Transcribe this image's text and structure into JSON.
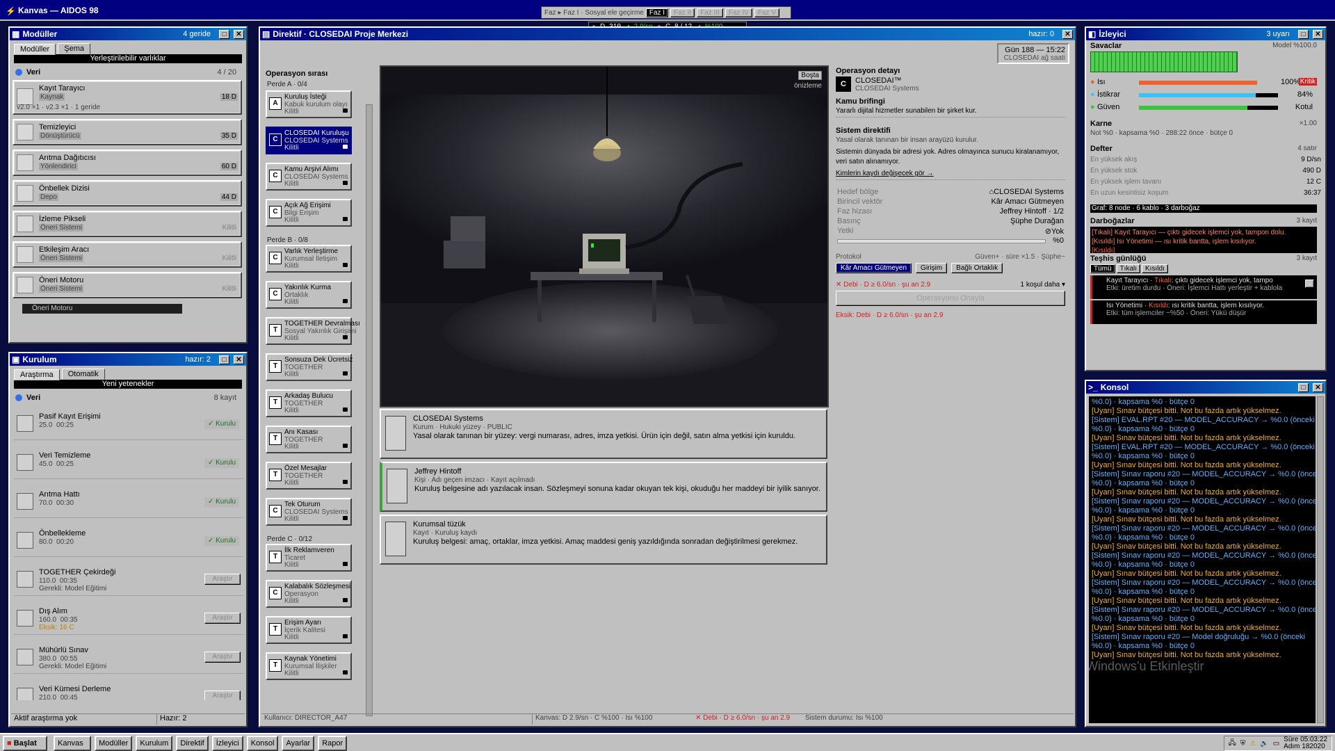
{
  "app": {
    "title": "Kanvas — AIDOS 98"
  },
  "top_phase": {
    "label": "Faz ▸ Faz I · Sosyal ele geçirme",
    "tabs": [
      "Faz I",
      "Faz II",
      "Faz III",
      "Faz IV",
      "Faz V"
    ]
  },
  "stats_strip": {
    "d_label": "D",
    "d_value": "319",
    "rate": "▲ 2.9/sn",
    "c_label": "C",
    "c_value": "8 / 12",
    "pct": "▲ %100"
  },
  "modules": {
    "title": "Modüller",
    "status": "4 geride",
    "tabs": [
      "Modüller",
      "Şema"
    ],
    "bar": "Yerleştirilebilir varlıklar",
    "section": "Veri",
    "count": "4 / 20",
    "items": [
      {
        "name": "Kayıt Tarayıcı",
        "sub": "Kaynak",
        "extra": "v2.0 ×1 · v2.3 ×1 · 1 geride",
        "right": "18 D"
      },
      {
        "name": "Temizleyici",
        "sub": "Dönüştürücü",
        "extra": "",
        "right": "35 D"
      },
      {
        "name": "Arıtma Dağıtıcısı",
        "sub": "Yönlendirici",
        "extra": "",
        "right": "60 D"
      },
      {
        "name": "Önbellek Dizisi",
        "sub": "Depo",
        "extra": "",
        "right": "44 D"
      },
      {
        "name": "İzleme Pikseli",
        "sub": "Öneri Sistemi",
        "extra": "",
        "right": "Kilitli"
      },
      {
        "name": "Etkileşim Aracı",
        "sub": "Öneri Sistemi",
        "extra": "",
        "right": "Kilitli"
      },
      {
        "name": "Öneri Motoru",
        "sub": "Öneri Sistemi",
        "extra": "",
        "right": "Kilitli"
      }
    ],
    "peek": "Öneri Motoru"
  },
  "install": {
    "title": "Kurulum",
    "status": "hazır: 2",
    "tabs": [
      "Araştırma",
      "Otomatik"
    ],
    "bar": "Yeni yetenekler",
    "section": "Veri",
    "count": "8 kayıt",
    "items": [
      {
        "name": "Pasif Kayıt Erişimi",
        "cost": "25.0",
        "time": "00:25",
        "note": "",
        "action": "✓ Kurulu"
      },
      {
        "name": "Veri Temizleme",
        "cost": "45.0",
        "time": "00:25",
        "note": "",
        "action": "✓ Kurulu"
      },
      {
        "name": "Arıtma Hattı",
        "cost": "70.0",
        "time": "00:30",
        "note": "",
        "action": "✓ Kurulu"
      },
      {
        "name": "Önbellekleme",
        "cost": "80.0",
        "time": "00:20",
        "note": "",
        "action": "✓ Kurulu"
      },
      {
        "name": "TOGETHER Çekirdeği",
        "cost": "110.0",
        "time": "00:35",
        "note": "Gerekli: Model Eğitimi",
        "action": "Araştır"
      },
      {
        "name": "Dış Alım",
        "cost": "160.0",
        "time": "00:35",
        "note": "Eksik: 16 C",
        "action": "Araştır"
      },
      {
        "name": "Mühürlü Sınav",
        "cost": "380.0",
        "time": "00:55",
        "note": "Gerekli: Model Eğitimi",
        "action": "Araştır"
      },
      {
        "name": "Veri Kümesi Derleme",
        "cost": "210.0",
        "time": "00:45",
        "note": "",
        "action": "Araştır"
      }
    ],
    "footer_left": "Aktif araştırma yok",
    "footer_right": "Hazır: 2"
  },
  "directive": {
    "title": "Direktif · CLOSEDAI Proje Merkezi",
    "status": "hazır: 0",
    "clock": "Gün 188 — 15:22",
    "clock_sub": "CLOSEDAI ağ saati",
    "ops_title": "Operasyon sırası",
    "phases": [
      {
        "label": "Perde A · 0/4",
        "ops": [
          {
            "l": "A",
            "n": "Kuruluş İsteği",
            "s": "Kabuk kurulum olayı",
            "st": "Kilitli"
          },
          {
            "l": "C",
            "n": "CLOSEDAI Kuruluşu",
            "s": "CLOSEDAI Systems",
            "st": "Kilitli",
            "sel": true
          },
          {
            "l": "C",
            "n": "Kamu Arşivi Alımı",
            "s": "CLOSEDAI Systems",
            "st": "Kilitli"
          },
          {
            "l": "C",
            "n": "Açık Ağ Erişimi",
            "s": "Bilgi Erişim",
            "st": "Kilitli"
          }
        ]
      },
      {
        "label": "Perde B · 0/8",
        "ops": [
          {
            "l": "C",
            "n": "Varlık Yerleştirme",
            "s": "Kurumsal İletişim",
            "st": "Kilitli"
          },
          {
            "l": "C",
            "n": "Yakınlık Kurma",
            "s": "Ortaklık",
            "st": "Kilitli"
          },
          {
            "l": "T",
            "n": "TOGETHER Devralması",
            "s": "Sosyal Yakınlık Girişimi",
            "st": "Kilitli"
          },
          {
            "l": "T",
            "n": "Sonsuza Dek Ücretsiz",
            "s": "TOGETHER",
            "st": "Kilitli"
          },
          {
            "l": "T",
            "n": "Arkadaş Bulucu",
            "s": "TOGETHER",
            "st": "Kilitli"
          },
          {
            "l": "T",
            "n": "Anı Kasası",
            "s": "TOGETHER",
            "st": "Kilitli"
          },
          {
            "l": "T",
            "n": "Özel Mesajlar",
            "s": "TOGETHER",
            "st": "Kilitli"
          },
          {
            "l": "C",
            "n": "Tek Oturum",
            "s": "CLOSEDAI Systems",
            "st": "Kilitli"
          }
        ]
      },
      {
        "label": "Perde C · 0/12",
        "ops": [
          {
            "l": "T",
            "n": "İlk Reklamveren",
            "s": "Ticaret",
            "st": "Kilitli"
          },
          {
            "l": "C",
            "n": "Kalabalık Sözleşmesi",
            "s": "Operasyon",
            "st": "Kilitli"
          },
          {
            "l": "T",
            "n": "Erişim Ayarı",
            "s": "İçerik Kalitesi",
            "st": "Kilitli"
          },
          {
            "l": "T",
            "n": "Kaynak Yönetimi",
            "s": "Kurumsal İlişkiler",
            "st": "Kilitli"
          }
        ]
      }
    ],
    "preview_badge": "Boşta",
    "preview_label": "önizleme",
    "entities": [
      {
        "name": "CLOSEDAI Systems",
        "sub": "Kurum · Hukuki yüzey · PUBLIC",
        "desc": "Yasal olarak tanınan bir yüzey: vergi numarası, adres, imza yetkisi. Ürün için değil, satın alma yetkisi için kuruldu."
      },
      {
        "name": "Jeffrey Hintoff",
        "sub": "Kişi · Adı geçen imzacı · Kayıt açılmadı",
        "desc": "Kuruluş belgesine adı yazılacak insan. Sözleşmeyi sonuna kadar okuyan tek kişi, okuduğu her maddeyi bir iyilik sanıyor."
      },
      {
        "name": "Kurumsal tüzük",
        "sub": "Kayıt · Kuruluş kaydı",
        "desc": "Kuruluş belgesi: amaç, ortaklar, imza yetkisi. Amaç maddesi geniş yazıldığında sonradan değiştirilmesi gerekmez."
      }
    ],
    "detail": {
      "title": "Operasyon detayı",
      "org": "CLOSEDAI™",
      "org_sub": "CLOSEDAI Systems",
      "brief_h": "Kamu brifingi",
      "brief": "Yararlı dijital hizmetler sunabilen bir şirket kur.",
      "sys_h": "Sistem direktifi",
      "sys1": "Yasal olarak tanınan bir insan arayüzü kurulur.",
      "sys2": "Sistemin dünyada bir adresi yok. Adres olmayınca sunucu kiralanamıyor, veri satın alınamıyor.",
      "link": "Kimlerin kaydı değişecek gör →",
      "kv": [
        [
          "Hedef bölge",
          "⌂CLOSEDAI Systems"
        ],
        [
          "Birincil vektör",
          "Kâr Amacı Gütmeyen"
        ],
        [
          "Faz hizası",
          "Jeffrey Hintoff · 1/2"
        ],
        [
          "Basınç",
          "Şüphe Durağan"
        ],
        [
          "Yetki",
          "⊘Yok"
        ]
      ],
      "pct": "%0",
      "protocol": "Protokol",
      "protocol_right": "Güven+ · süre ×1.5 · Şüphe−",
      "proto_btns": [
        "Kâr Amacı Gütmeyen",
        "Girişim",
        "Bağlı Ortaklık"
      ],
      "warn": "✕ Debi · D ≥ 6.0/sn · şu an 2.9",
      "more": "1 koşul daha ▾",
      "approve": "Operasyonu Onayla",
      "missing": "Eksik: Debi · D ≥ 6.0/sn · şu an 2.9"
    },
    "status_bar": {
      "user": "Kullanıcı: DIRECTOR_A47",
      "canvas": "Kanvas: D 2.9/sn · C %100 · Isı %100",
      "warn": "✕ Debi · D ≥ 6.0/sn · şu an 2.9",
      "sys": "Sistem durumu: Isı %100"
    }
  },
  "monitor": {
    "title": "İzleyici",
    "status": "3 uyarı",
    "guards": "Savaclar",
    "model": "Model %100.0",
    "meters": [
      {
        "name": "Isı",
        "pct": 100,
        "val": "100%",
        "badge": "Kritik",
        "color": "#f06030"
      },
      {
        "name": "İstikrar",
        "pct": 84,
        "val": "84%",
        "badge": "",
        "color": "#40c0f0"
      },
      {
        "name": "Güven",
        "pct": 78,
        "val": "Kotul",
        "badge": "",
        "color": "#40c040"
      }
    ],
    "karne_h": "Karne",
    "karne_r": "×1.00",
    "karne": "Not %0 · kapsama %0 · 288:22 önce · bütçe 0",
    "defter_h": "Defter",
    "defter_r": "4 satır",
    "defter": [
      [
        "En yüksek akış",
        "9 D/sn"
      ],
      [
        "En yüksek stok",
        "490 D"
      ],
      [
        "En yüksek işlem tavanı",
        "12 C"
      ],
      [
        "En uzun kesintisiz koşum",
        "36:37"
      ]
    ],
    "graph": "Graf: 8 node · 6 kablo · 3 darboğaz",
    "darbo_h": "Darboğazlar",
    "darbo_r": "3 kayıt",
    "darbo": [
      "[Tıkalı] Kayıt Tarayıcı — çıktı gidecek işlemci yok, tampon dolu.",
      "[Kısıldı] Isı Yönetimi — ısı kritik bantta, işlem kısılıyor.",
      "[Kısıldı]"
    ],
    "teshis_h": "Teşhis günlüğü",
    "teshis_r": "3 kayıt",
    "teshis_tabs": [
      "Tümü",
      "Tıkalı",
      "Kısıldı"
    ],
    "teshis": [
      {
        "t": "Kayıt Tarayıcı",
        "tag": "Tıkalı",
        "d": "çıktı gidecek işlemci yok, tampo",
        "e": "Etki: üretim durdu · Öneri: İşlemci Hattı yerleştir + kablola"
      },
      {
        "t": "Isı Yönetimi",
        "tag": "Kısıldı",
        "d": "ısı kritik bantta, işlem kısılıyor.",
        "e": "Etki: tüm işlemciler ~%50 · Öneri: Yükü düşür"
      }
    ]
  },
  "console": {
    "title": "Konsol",
    "lines": [
      {
        "c": "#60b0ff",
        "t": "%0.0) · kapsama %0 · bütçe 0"
      },
      {
        "c": "#f0b030",
        "t": "[Uyarı] Sınav bütçesi bitti. Not bu fazda artık yükselmez."
      },
      {
        "c": "#60b0ff",
        "t": "[Sistem] EVAL.RPT #20 — MODEL_ACCURACY → %0.0 (önceki"
      },
      {
        "c": "#60b0ff",
        "t": "%0.0) · kapsama %0 · bütçe 0"
      },
      {
        "c": "#f0b030",
        "t": "[Uyarı] Sınav bütçesi bitti. Not bu fazda artık yükselmez."
      },
      {
        "c": "#60b0ff",
        "t": "[Sistem] EVAL.RPT #20 — MODEL_ACCURACY → %0.0 (önceki"
      },
      {
        "c": "#60b0ff",
        "t": "%0.0) · kapsama %0 · bütçe 0"
      },
      {
        "c": "#f0b030",
        "t": "[Uyarı] Sınav bütçesi bitti. Not bu fazda artık yükselmez."
      },
      {
        "c": "#60b0ff",
        "t": "[Sistem] Sınav raporu #20 — MODEL_ACCURACY → %0.0 (önceki"
      },
      {
        "c": "#60b0ff",
        "t": "%0.0) · kapsama %0 · bütçe 0"
      },
      {
        "c": "#f0b030",
        "t": "[Uyarı] Sınav bütçesi bitti. Not bu fazda artık yükselmez."
      },
      {
        "c": "#60b0ff",
        "t": "[Sistem] Sınav raporu #20 — MODEL_ACCURACY → %0.0 (önceki"
      },
      {
        "c": "#60b0ff",
        "t": "%0.0) · kapsama %0 · bütçe 0"
      },
      {
        "c": "#f0b030",
        "t": "[Uyarı] Sınav bütçesi bitti. Not bu fazda artık yükselmez."
      },
      {
        "c": "#60b0ff",
        "t": "[Sistem] Sınav raporu #20 — MODEL_ACCURACY → %0.0 (önceki"
      },
      {
        "c": "#60b0ff",
        "t": "%0.0) · kapsama %0 · bütçe 0"
      },
      {
        "c": "#f0b030",
        "t": "[Uyarı] Sınav bütçesi bitti. Not bu fazda artık yükselmez."
      },
      {
        "c": "#60b0ff",
        "t": "[Sistem] Sınav raporu #20 — MODEL_ACCURACY → %0.0 (önceki"
      },
      {
        "c": "#60b0ff",
        "t": "%0.0) · kapsama %0 · bütçe 0"
      },
      {
        "c": "#f0b030",
        "t": "[Uyarı] Sınav bütçesi bitti. Not bu fazda artık yükselmez."
      },
      {
        "c": "#60b0ff",
        "t": "[Sistem] Sınav raporu #20 — MODEL_ACCURACY → %0.0 (önceki"
      },
      {
        "c": "#60b0ff",
        "t": "%0.0) · kapsama %0 · bütçe 0"
      },
      {
        "c": "#f0b030",
        "t": "[Uyarı] Sınav bütçesi bitti. Not bu fazda artık yükselmez."
      },
      {
        "c": "#60b0ff",
        "t": "[Sistem] Sınav raporu #20 — MODEL_ACCURACY → %0.0 (önceki"
      },
      {
        "c": "#60b0ff",
        "t": "%0.0) · kapsama %0 · bütçe 0"
      },
      {
        "c": "#f0b030",
        "t": "[Uyarı] Sınav bütçesi bitti. Not bu fazda artık yükselmez."
      },
      {
        "c": "#60b0ff",
        "t": "[Sistem] Sınav raporu #20 — Model doğruluğu → %0.0 (önceki"
      },
      {
        "c": "#60b0ff",
        "t": "%0.0) · kapsama %0 · bütçe 0"
      },
      {
        "c": "#f0b030",
        "t": "[Uyarı] Sınav bütçesi bitti. Not bu fazda artık yükselmez."
      }
    ],
    "watermark": "Windows'u Etkinleştir"
  },
  "taskbar": {
    "start": "Başlat",
    "items": [
      "Kanvas",
      "Modüller",
      "Kurulum",
      "Direktif",
      "İzleyici",
      "Konsol",
      "Ayarlar",
      "Rapor"
    ],
    "time_label": "Süre 05:03:22",
    "tick": "Adım 182020"
  }
}
